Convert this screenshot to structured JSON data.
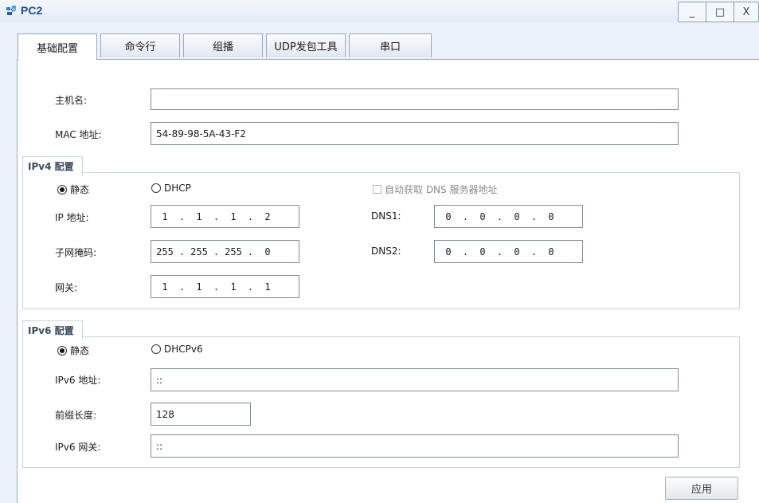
{
  "window": {
    "title": "PC2",
    "minimize": "_",
    "maximize": "□",
    "close": "X"
  },
  "tabs": [
    {
      "label": "基础配置",
      "active": true
    },
    {
      "label": "命令行"
    },
    {
      "label": "组播"
    },
    {
      "label": "UDP发包工具"
    },
    {
      "label": "串口"
    }
  ],
  "basic": {
    "hostname_label": "主机名:",
    "hostname_value": "",
    "mac_label": "MAC 地址:",
    "mac_value": "54-89-98-5A-43-F2"
  },
  "ipv4": {
    "group_title": "IPv4 配置",
    "static_label": "静态",
    "dhcp_label": "DHCP",
    "mode": "static",
    "auto_dns_label": "自动获取 DNS 服务器地址",
    "auto_dns_checked": false,
    "ip_label": "IP 地址:",
    "ip": [
      "1",
      "1",
      "1",
      "2"
    ],
    "mask_label": "子网掩码:",
    "mask": [
      "255",
      "255",
      "255",
      "0"
    ],
    "gateway_label": "网关:",
    "gateway": [
      "1",
      "1",
      "1",
      "1"
    ],
    "dns1_label": "DNS1:",
    "dns1": [
      "0",
      "0",
      "0",
      "0"
    ],
    "dns2_label": "DNS2:",
    "dns2": [
      "0",
      "0",
      "0",
      "0"
    ]
  },
  "ipv6": {
    "group_title": "IPv6 配置",
    "static_label": "静态",
    "dhcp_label": "DHCPv6",
    "mode": "static",
    "addr_label": "IPv6 地址:",
    "addr_value": "::",
    "prefix_label": "前缀长度:",
    "prefix_value": "128",
    "gateway_label": "IPv6 网关:",
    "gateway_value": "::"
  },
  "apply_label": "应用"
}
